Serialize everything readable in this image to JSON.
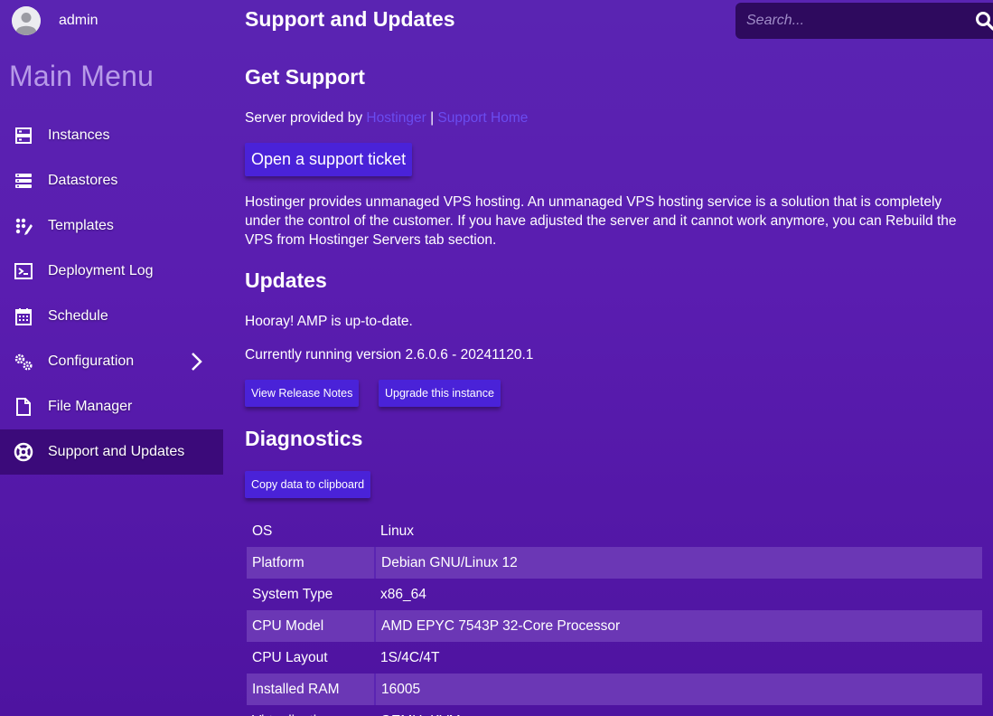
{
  "user": {
    "name": "admin"
  },
  "sidebar": {
    "title": "Main Menu",
    "items": [
      {
        "label": "Instances",
        "icon": "server-icon"
      },
      {
        "label": "Datastores",
        "icon": "database-icon"
      },
      {
        "label": "Templates",
        "icon": "templates-icon"
      },
      {
        "label": "Deployment Log",
        "icon": "terminal-icon"
      },
      {
        "label": "Schedule",
        "icon": "calendar-icon"
      },
      {
        "label": "Configuration",
        "icon": "gears-icon"
      },
      {
        "label": "File Manager",
        "icon": "file-icon"
      },
      {
        "label": "Support and Updates",
        "icon": "lifebuoy-icon"
      }
    ]
  },
  "header": {
    "title": "Support and Updates",
    "search_placeholder": "Search..."
  },
  "support": {
    "heading": "Get Support",
    "provided_by": "Server provided by",
    "provider_link": "Hostinger",
    "separator": "|",
    "support_home_link": "Support Home",
    "ticket_button": "Open a support ticket",
    "description": "Hostinger provides unmanaged VPS hosting. An unmanaged VPS hosting service is a solution that is completely under the control of the customer. If you have adjusted the server and it cannot work anymore, you can Rebuild the VPS from Hostinger Servers tab section."
  },
  "updates": {
    "heading": "Updates",
    "status": "Hooray! AMP is up-to-date.",
    "version": "Currently running version 2.6.0.6 - 20241120.1",
    "release_notes_button": "View Release Notes",
    "upgrade_button": "Upgrade this instance"
  },
  "diagnostics": {
    "heading": "Diagnostics",
    "copy_button": "Copy data to clipboard",
    "rows": [
      {
        "key": "OS",
        "value": "Linux"
      },
      {
        "key": "Platform",
        "value": "Debian GNU/Linux 12"
      },
      {
        "key": "System Type",
        "value": "x86_64"
      },
      {
        "key": "CPU Model",
        "value": "AMD EPYC 7543P 32-Core Processor"
      },
      {
        "key": "CPU Layout",
        "value": "1S/4C/4T"
      },
      {
        "key": "Installed RAM",
        "value": "16005"
      },
      {
        "key": "Virtualization",
        "value": "QEMU_KVM"
      }
    ]
  },
  "colors": {
    "background": "#5a24b2",
    "active_menu": "#3b0a7a",
    "button": "#4a22d8",
    "link": "#6a4cf0",
    "menu_title": "#b79ae8"
  }
}
